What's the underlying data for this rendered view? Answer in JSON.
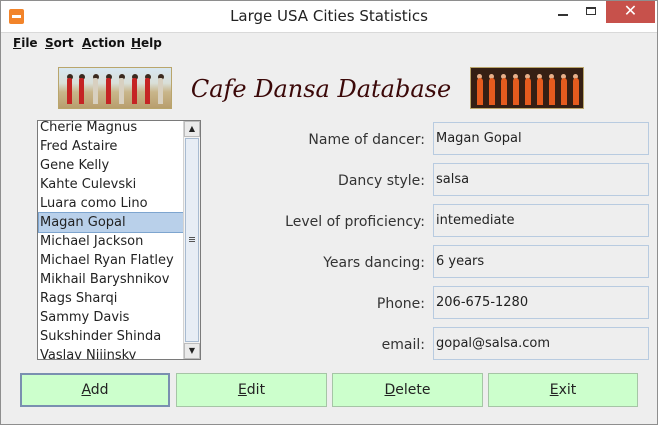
{
  "window": {
    "title": "Large USA Cities Statistics"
  },
  "menu": [
    {
      "first": "F",
      "rest": "ile"
    },
    {
      "first": "S",
      "rest": "ort"
    },
    {
      "first": "A",
      "rest": "ction"
    },
    {
      "first": "H",
      "rest": "elp"
    }
  ],
  "header": {
    "title": "Cafe Dansa Database"
  },
  "dancer_list": {
    "items": [
      "Cherie Magnus",
      "Fred Astaire",
      "Gene Kelly",
      "Kahte Culevski",
      "Luara como Lino",
      "Magan Gopal",
      "Michael Jackson",
      "Michael Ryan Flatley",
      "Mikhail Baryshnikov",
      "Rags Sharqi",
      "Sammy Davis",
      "Sukshinder Shinda",
      "Vaslav Nijinsky"
    ],
    "selected": "Magan Gopal"
  },
  "details": {
    "name": {
      "label": "Name of dancer:",
      "value": "Magan Gopal"
    },
    "style": {
      "label": "Dancy style:",
      "value": "salsa"
    },
    "level": {
      "label": "Level of proficiency:",
      "value": "intemediate"
    },
    "years": {
      "label": "Years dancing:",
      "value": "6 years"
    },
    "phone": {
      "label": "Phone:",
      "value": "206-675-1280"
    },
    "email": {
      "label": "email:",
      "value": "gopal@salsa.com"
    }
  },
  "buttons": [
    {
      "first": "A",
      "rest": "dd"
    },
    {
      "first": "E",
      "rest": "dit"
    },
    {
      "first": "D",
      "rest": "elete"
    },
    {
      "first": "E",
      "rest": "xit"
    }
  ],
  "colors": {
    "button_bg": "#ccffcc",
    "title_text": "#3b0808",
    "selection": "#b9d0ea",
    "close_button": "#c7514b"
  }
}
